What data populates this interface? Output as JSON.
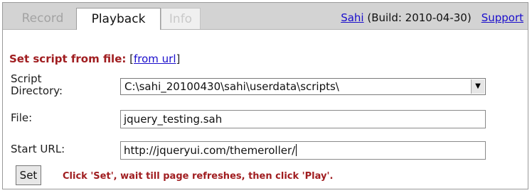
{
  "tabs": {
    "record": "Record",
    "playback": "Playback",
    "info": "Info"
  },
  "header": {
    "sahi_link": "Sahi",
    "build": " (Build: 2010-04-30)",
    "support_link": "Support"
  },
  "form": {
    "heading": "Set script from file:",
    "from_url_prefix": " [",
    "from_url_link": "from url",
    "from_url_suffix": "]",
    "script_dir_label": "Script Directory:",
    "script_dir_value": "C:\\sahi_20100430\\sahi\\userdata\\scripts\\",
    "file_label": "File:",
    "file_value": "jquery_testing.sah",
    "start_url_label": "Start URL:",
    "start_url_value": "http://jqueryui.com/themeroller/",
    "set_button": "Set",
    "hint": "Click 'Set', wait till page refreshes, then click 'Play'."
  },
  "colors": {
    "accent_red": "#a01d20",
    "link_blue": "#1a0dcc",
    "toolbar_gray": "#d3d3d3"
  },
  "icons": {
    "dropdown": "chevron-down-icon"
  }
}
